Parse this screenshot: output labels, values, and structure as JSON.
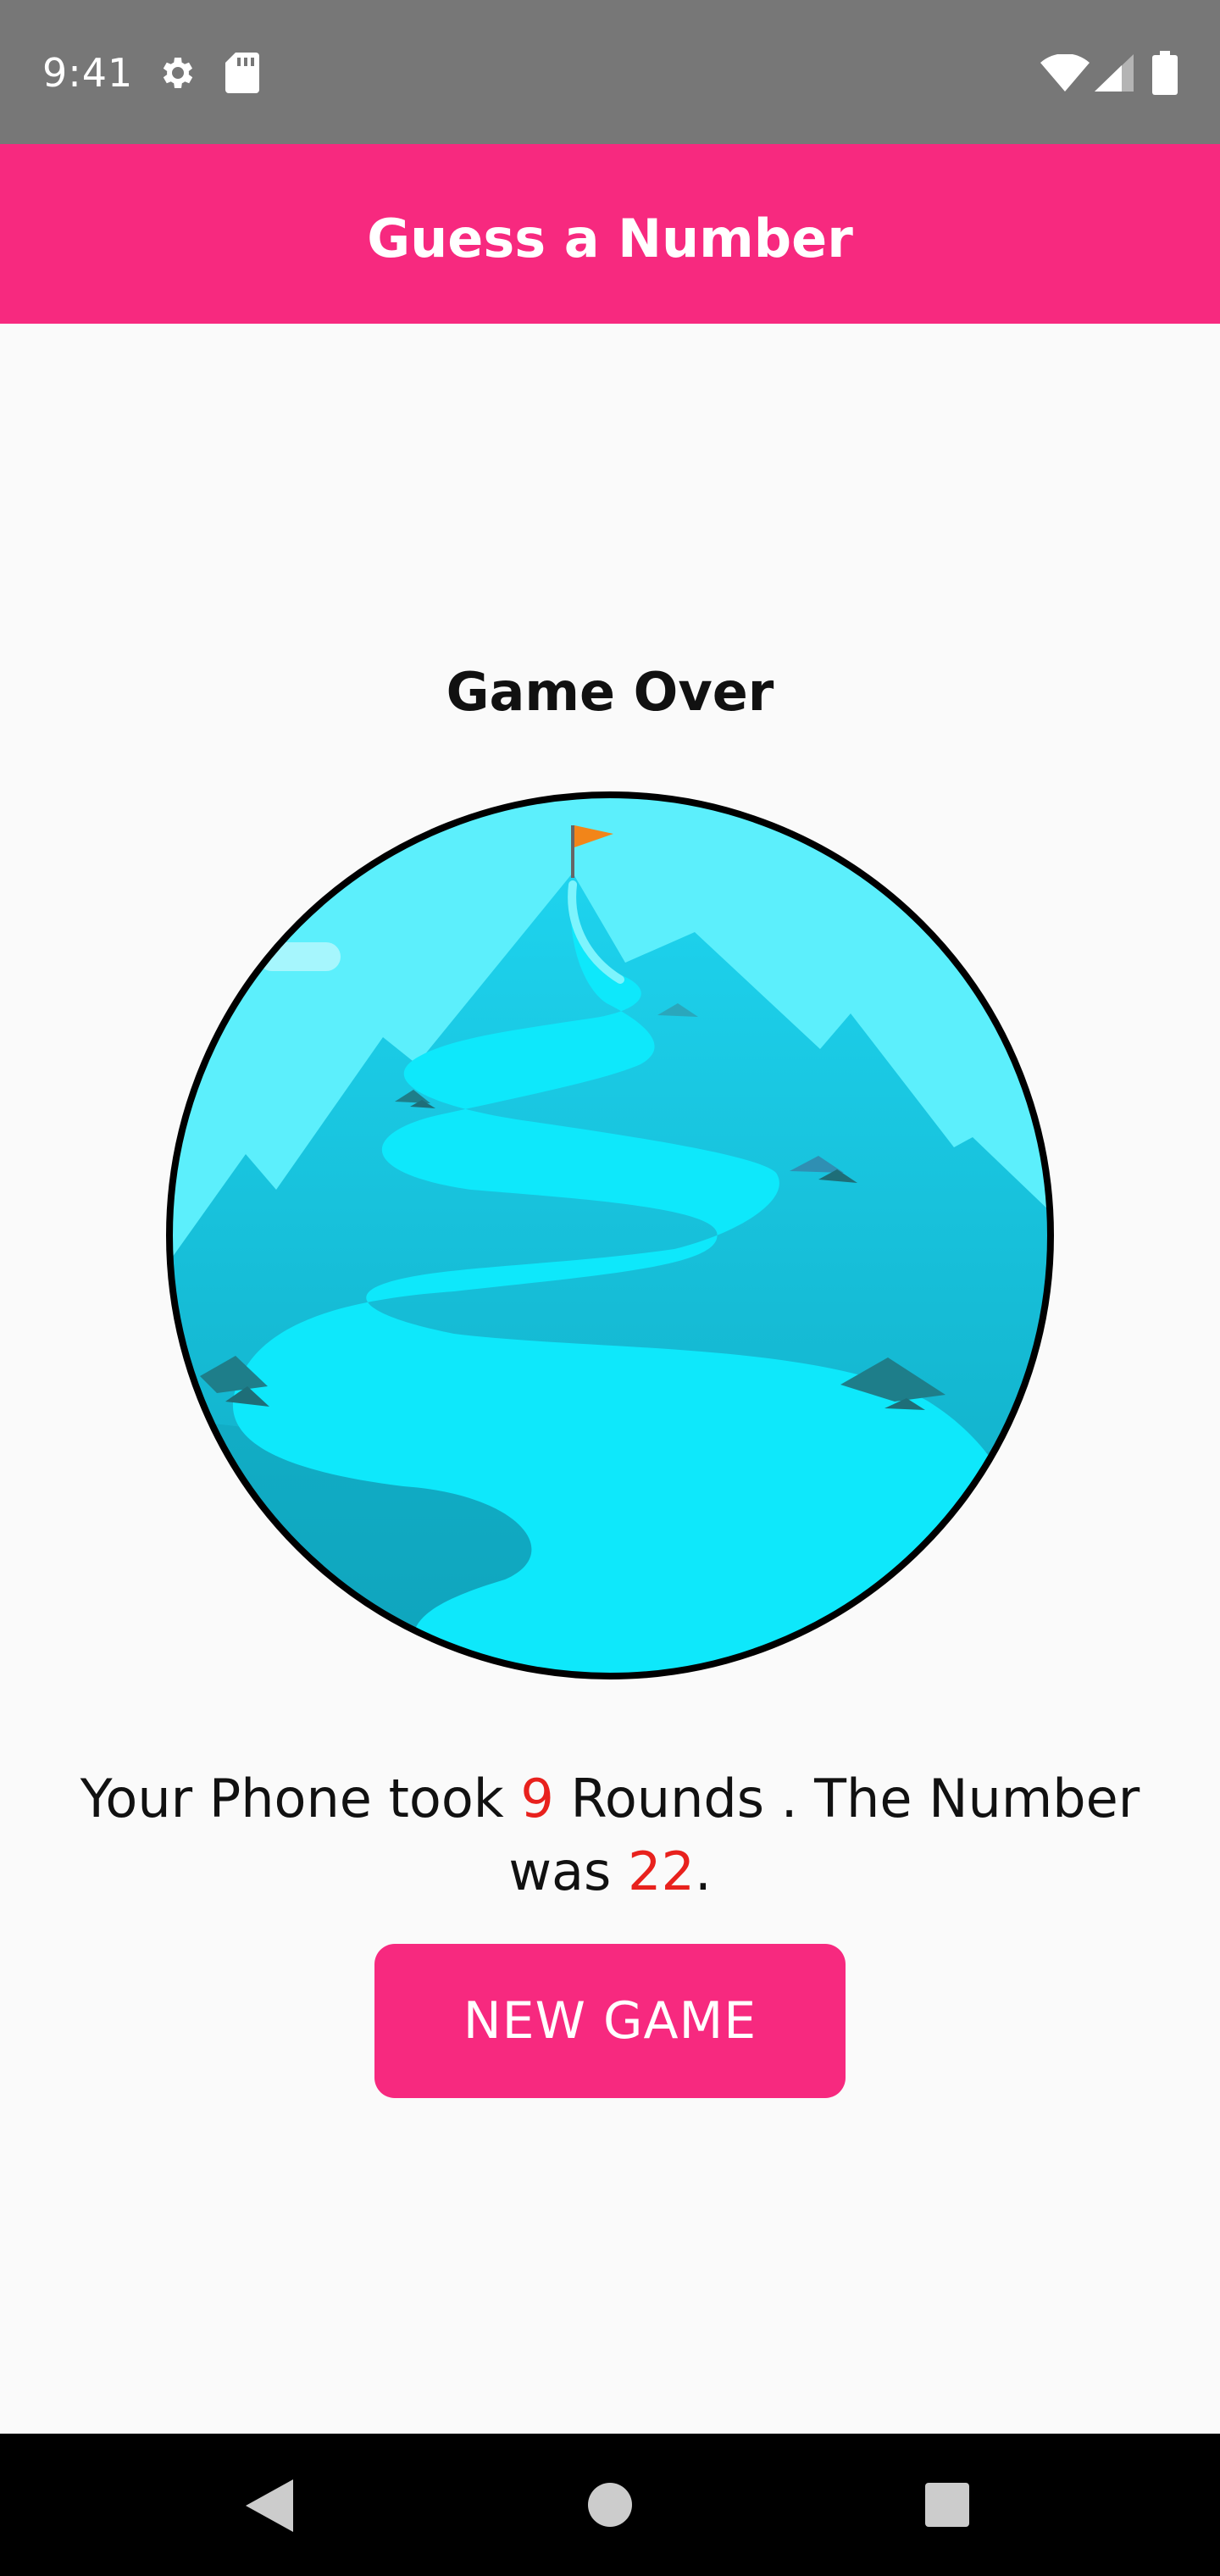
{
  "status_bar": {
    "time": "9:41",
    "icons": [
      "gear-icon",
      "sd-card-icon",
      "wifi-icon",
      "signal-icon",
      "battery-icon"
    ]
  },
  "app_bar": {
    "title": "Guess a Number",
    "color": "#f7297f"
  },
  "game_over": {
    "title": "Game Over",
    "image": "mountain-summit-illustration",
    "result": {
      "prefix": "Your Phone took ",
      "rounds": "9",
      "middle": " Rounds . The Number was ",
      "number": "22",
      "suffix": "."
    },
    "highlight_color": "#e8211d"
  },
  "button": {
    "label": "NEW GAME"
  },
  "nav_bar": {
    "icons": [
      "back-icon",
      "home-icon",
      "recents-icon"
    ]
  }
}
